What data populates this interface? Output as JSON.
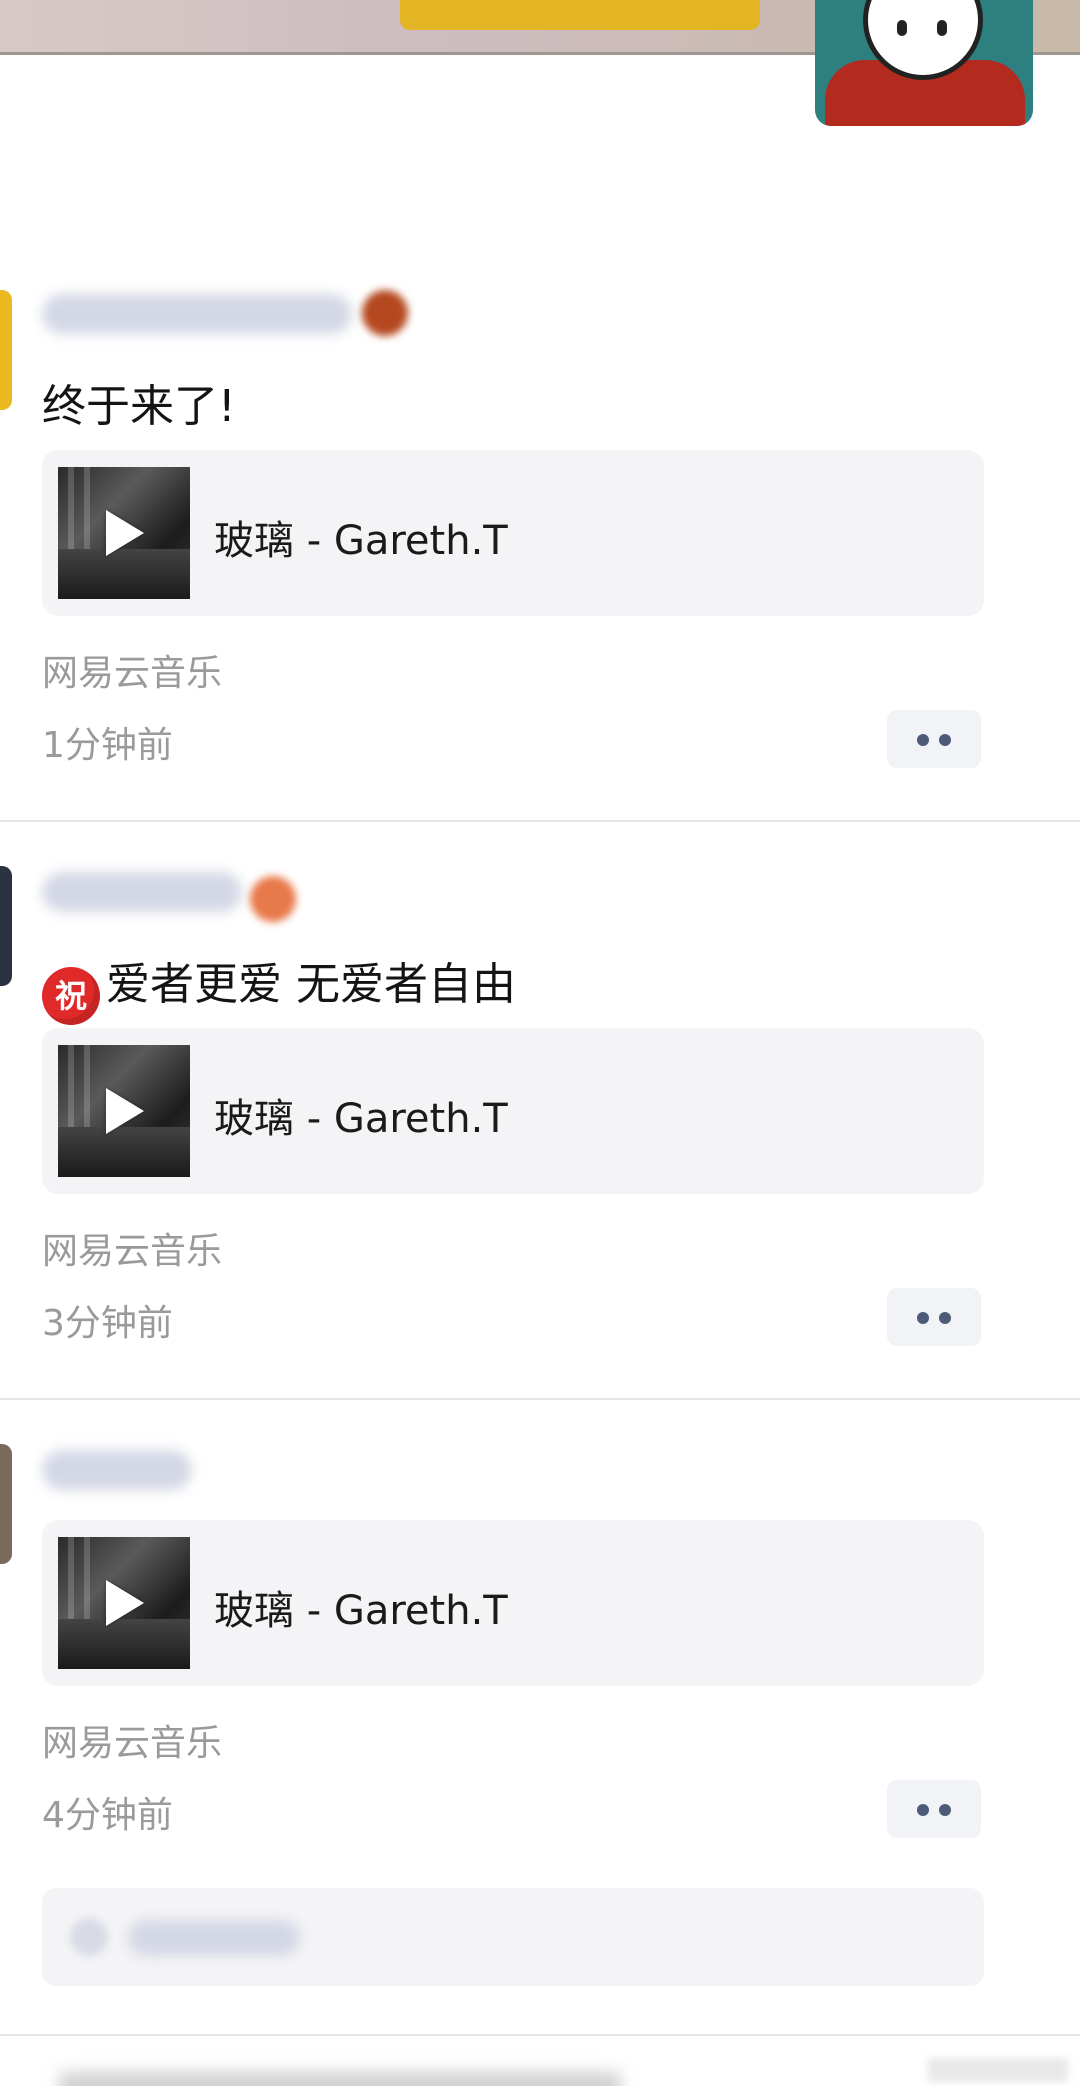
{
  "colors": {
    "accent_badge": "#e02a2a",
    "card_bg": "#f4f4f6",
    "muted_text": "#9a9a9a",
    "more_dots": "#4d5b78"
  },
  "posts": [
    {
      "text": "终于来了!",
      "badge": "",
      "music": {
        "title": "玻璃 - Gareth.T"
      },
      "source": "网易云音乐",
      "time": "1分钟前"
    },
    {
      "text": "爱者更爱 无爱者自由",
      "badge": "祝",
      "music": {
        "title": "玻璃 - Gareth.T"
      },
      "source": "网易云音乐",
      "time": "3分钟前"
    },
    {
      "text": "",
      "badge": "",
      "music": {
        "title": "玻璃 - Gareth.T"
      },
      "source": "网易云音乐",
      "time": "4分钟前"
    }
  ],
  "icons": {
    "play": "play-icon",
    "more": "more-dots-icon"
  }
}
